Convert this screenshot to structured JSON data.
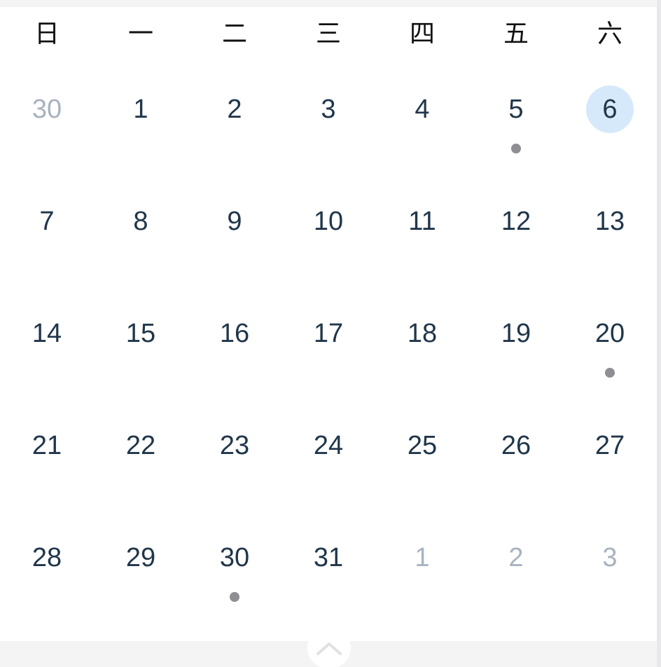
{
  "calendar": {
    "weekdays": [
      "日",
      "一",
      "二",
      "三",
      "四",
      "五",
      "六"
    ],
    "weeks": [
      [
        {
          "day": "30",
          "muted": true
        },
        {
          "day": "1"
        },
        {
          "day": "2"
        },
        {
          "day": "3"
        },
        {
          "day": "4"
        },
        {
          "day": "5",
          "event": true
        },
        {
          "day": "6",
          "selected": true
        }
      ],
      [
        {
          "day": "7"
        },
        {
          "day": "8"
        },
        {
          "day": "9"
        },
        {
          "day": "10"
        },
        {
          "day": "11"
        },
        {
          "day": "12"
        },
        {
          "day": "13"
        }
      ],
      [
        {
          "day": "14"
        },
        {
          "day": "15"
        },
        {
          "day": "16"
        },
        {
          "day": "17"
        },
        {
          "day": "18"
        },
        {
          "day": "19"
        },
        {
          "day": "20",
          "event": true
        }
      ],
      [
        {
          "day": "21"
        },
        {
          "day": "22"
        },
        {
          "day": "23"
        },
        {
          "day": "24"
        },
        {
          "day": "25"
        },
        {
          "day": "26"
        },
        {
          "day": "27"
        }
      ],
      [
        {
          "day": "28"
        },
        {
          "day": "29"
        },
        {
          "day": "30",
          "event": true
        },
        {
          "day": "31"
        },
        {
          "day": "1",
          "muted": true
        },
        {
          "day": "2",
          "muted": true
        },
        {
          "day": "3",
          "muted": true
        }
      ]
    ],
    "colors": {
      "day_text": "#20364a",
      "muted_text": "#a8b3bf",
      "selected_fill": "#d6e9fb",
      "event_dot": "#8e8e93"
    },
    "collapse_icon": "chevron-up-icon"
  }
}
